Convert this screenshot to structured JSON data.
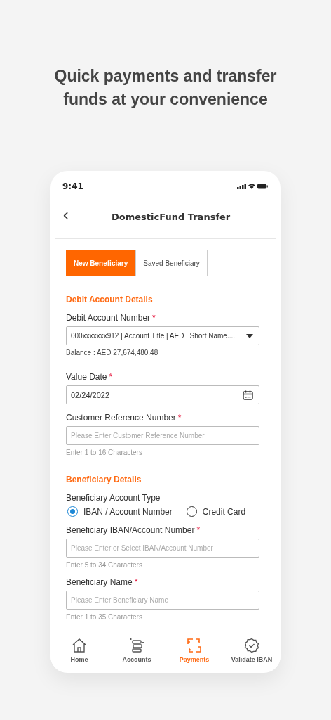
{
  "headline": "Quick payments and transfer funds at your convenience",
  "status_bar": {
    "time": "9:41"
  },
  "header": {
    "back": "‹",
    "title": "DomesticFund Transfer"
  },
  "tabs": [
    {
      "label": "New Beneficiary",
      "selected": true
    },
    {
      "label": "Saved Beneficiary",
      "selected": false
    }
  ],
  "sections": [
    {
      "title": "Debit Account Details",
      "fields": [
        {
          "kind": "select",
          "label": "Debit Account Number",
          "mark": "*",
          "value": "000xxxxxxx912 | Account Title | AED | Short Name....",
          "hint": "Balance : AED 27,674,480.48"
        },
        {
          "kind": "date",
          "label": "Value Date",
          "mark": "*",
          "value": "02/24/2022"
        },
        {
          "kind": "text",
          "label": "Customer Reference Number",
          "mark": "*",
          "placeholder": "Please Enter Customer Reference Number",
          "hint": "Enter 1 to 16 Characters"
        }
      ]
    },
    {
      "title": "Beneficiary Details",
      "fields": [
        {
          "kind": "radio",
          "label": "Beneficiary Account Type",
          "options": [
            {
              "label": "IBAN / Account Number",
              "selected": true
            },
            {
              "label": "Credit Card",
              "selected": false
            }
          ]
        },
        {
          "kind": "text",
          "label": "Beneficiary IBAN/Account Number",
          "mark": "*",
          "placeholder": "Please Enter or Select IBAN/Account Number",
          "hint": "Enter 5 to 34 Characters"
        },
        {
          "kind": "text",
          "label": "Beneficiary Name",
          "mark": "*",
          "placeholder": "Please Enter Beneficiary Name",
          "hint": "Enter 1 to 35 Characters"
        }
      ]
    }
  ],
  "nav": [
    {
      "label": "Home",
      "kind": "home",
      "selected": false
    },
    {
      "label": "Accounts",
      "kind": "accounts",
      "selected": false
    },
    {
      "label": "Payments",
      "kind": "payments",
      "selected": true
    },
    {
      "label": "Validate IBAN",
      "kind": "validate",
      "selected": false
    }
  ]
}
